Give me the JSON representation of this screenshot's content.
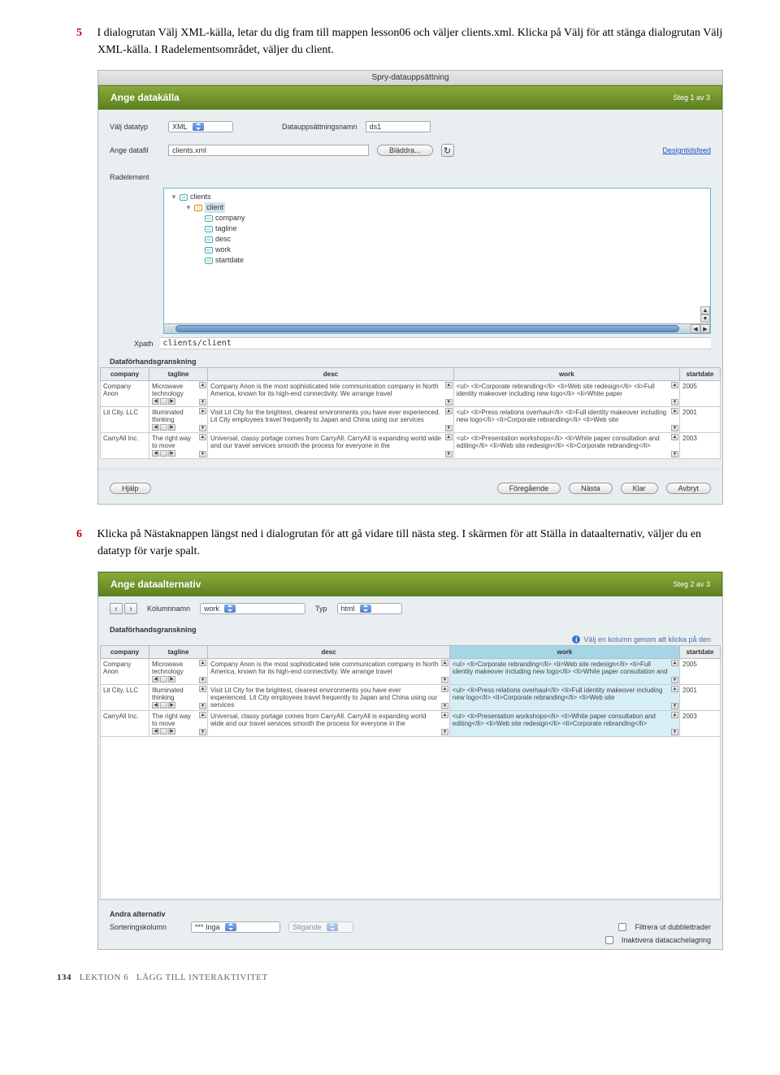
{
  "step5": {
    "num": "5",
    "text_a": "I dialogrutan Välj XML-källa, letar du dig fram till mappen lesson06 och väljer clients.xml. Klicka på Välj för att stänga dialogrutan Välj XML-källa. I Radelementsområdet, väljer du client."
  },
  "step6": {
    "num": "6",
    "text_a": "Klicka på Nästaknappen längst ned i dialogrutan för att gå vidare till nästa steg. I skärmen för att Ställa in dataalternativ, väljer du en datatyp för varje spalt."
  },
  "dialog1": {
    "titlebar": "Spry-datauppsättning",
    "header": "Ange datakälla",
    "step": "Steg 1 av 3",
    "labels": {
      "datatype": "Välj datatyp",
      "datatype_value": "XML",
      "dsname": "Datauppsättningsnamn",
      "ds_value": "ds1",
      "datafile": "Ange datafil",
      "datafile_value": "clients.xml",
      "browse": "Bläddra...",
      "designfeed": "Designtidsfeed",
      "rowelement": "Radelement",
      "xpath": "Xpath",
      "xpath_value": "clients/client",
      "preview_head": "Dataförhandsgranskning"
    },
    "tree": {
      "root": "clients",
      "sel": "client",
      "children": [
        "company",
        "tagline",
        "desc",
        "work",
        "startdate"
      ]
    },
    "columns": [
      "company",
      "tagline",
      "desc",
      "work",
      "startdate"
    ],
    "rows": [
      {
        "company": "Company Anon",
        "tagline": "Microwave technology",
        "desc": "Company Anon is the most sophisticated tele communication company in North America, known for its high-end connectivity. We arrange travel",
        "work": "<ul> <li>Corporate rebranding</li> <li>Web site redesign</li> <li>Full identity makeover including new logo</li> <li>White paper",
        "startdate": "2005"
      },
      {
        "company": "Lit City, LLC",
        "tagline": "Illuminated thinking",
        "desc": "Visit Lit City for the brightest, clearest environments you have ever experienced. Lit City employees travel frequently to Japan and China using our services",
        "work": "<ul> <li>Press relations overhaul</li> <li>Full identity makeover including new logo</li> <li>Corporate rebranding</li> <li>Web site",
        "startdate": "2001"
      },
      {
        "company": "CarryAll Inc.",
        "tagline": "The right way to move",
        "desc": "Universal, classy portage comes from CarryAll. CarryAll is expanding world wide and our travel services smooth the process for everyone in the",
        "work": "<ul> <li>Presentation workshops</li> <li>White paper consultation and editing</li> <li>Web site redesign</li> <li>Corporate rebranding</li>",
        "startdate": "2003"
      }
    ],
    "buttons": {
      "help": "Hjälp",
      "prev": "Föregående",
      "next": "Nästa",
      "done": "Klar",
      "cancel": "Avbryt"
    }
  },
  "dialog2": {
    "header": "Ange dataalternativ",
    "step": "Steg 2 av 3",
    "labels": {
      "colname": "Kolumnnamn",
      "colname_value": "work",
      "type": "Typ",
      "type_value": "html",
      "preview_head": "Dataförhandsgranskning",
      "info": "Välj en kolumn genom att klicka på den",
      "other_head": "Andra alternativ",
      "sortcol": "Sorteringskolumn",
      "sortcol_value": "*** Inga",
      "sortdir": "Stigande",
      "filter": "Filtrera ut dubblettrader",
      "cache": "Inaktivera datacachelagring"
    },
    "columns": [
      "company",
      "tagline",
      "desc",
      "work",
      "startdate"
    ],
    "rows": [
      {
        "company": "Company Anon",
        "tagline": "Microwave technology",
        "desc": "Company Anon is the most sophisticated tele communication company in North America, known for its high-end connectivity. We arrange travel",
        "work": "<ul> <li>Corporate rebranding</li> <li>Web site redesign</li> <li>Full identity makeover including new logo</li> <li>White paper consultation and",
        "startdate": "2005"
      },
      {
        "company": "Lit City, LLC",
        "tagline": "Illuminated thinking",
        "desc": "Visit Lit City for the brightest, clearest environments you have ever experienced. Lit City employees travel frequently to Japan and China using our services",
        "work": "<ul> <li>Press relations overhaul</li> <li>Full identity makeover including new logo</li> <li>Corporate rebranding</li> <li>Web site",
        "startdate": "2001"
      },
      {
        "company": "CarryAll Inc.",
        "tagline": "The right way to move",
        "desc": "Universal, classy portage comes from CarryAll. CarryAll is expanding world wide and our travel services smooth the process for everyone in the",
        "work": "<ul> <li>Presentation workshops</li> <li>White paper consultation and editing</li> <li>Web site redesign</li> <li>Corporate rebranding</li>",
        "startdate": "2003"
      }
    ]
  },
  "footer": {
    "page": "134",
    "lesson": "LEKTION 6",
    "title": "LÄGG TILL INTERAKTIVITET"
  }
}
